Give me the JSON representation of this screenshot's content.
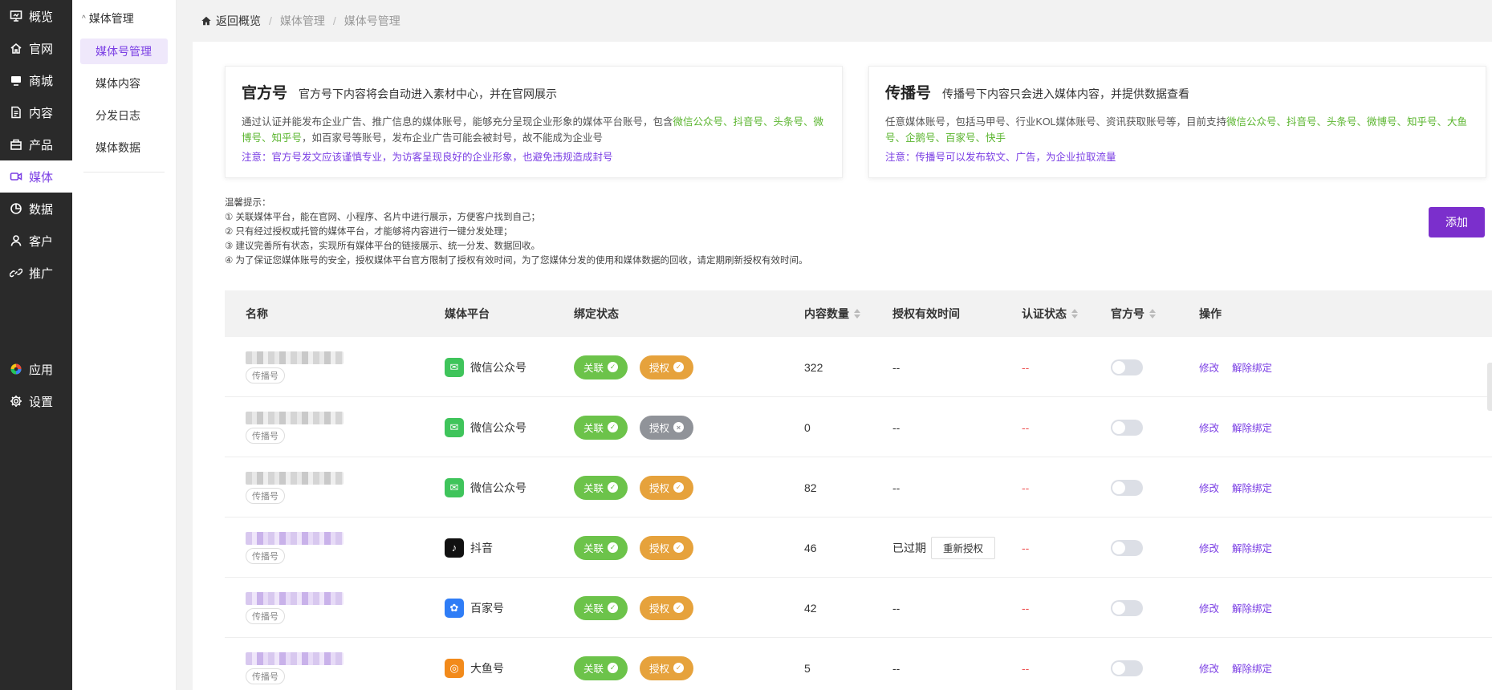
{
  "sidebar": {
    "items": [
      {
        "label": "概览",
        "icon": "dashboard-icon"
      },
      {
        "label": "官网",
        "icon": "home-icon"
      },
      {
        "label": "商城",
        "icon": "shop-icon"
      },
      {
        "label": "内容",
        "icon": "document-icon"
      },
      {
        "label": "产品",
        "icon": "product-icon"
      },
      {
        "label": "媒体",
        "icon": "media-icon",
        "active": true
      },
      {
        "label": "数据",
        "icon": "chart-icon"
      },
      {
        "label": "客户",
        "icon": "user-icon"
      },
      {
        "label": "推广",
        "icon": "link-icon"
      }
    ],
    "bottom": [
      {
        "label": "应用",
        "icon": "apps-icon"
      },
      {
        "label": "设置",
        "icon": "gear-icon"
      }
    ]
  },
  "submenu": {
    "title": "媒体管理",
    "items": [
      "媒体号管理",
      "媒体内容",
      "分发日志",
      "媒体数据"
    ]
  },
  "breadcrumb": {
    "home": "返回概览",
    "crumbs": [
      "媒体管理",
      "媒体号管理"
    ]
  },
  "cards": {
    "official": {
      "title": "官方号",
      "subtitle": "官方号下内容将会自动进入素材中心，并在官网展示",
      "desc_prefix": "通过认证并能发布企业广告、推广信息的媒体账号，能够充分呈现企业形象的媒体平台账号，包含",
      "desc_platforms": "微信公众号、抖音号、头条号、微博号、知乎号",
      "desc_suffix": "，如百家号等账号，发布企业广告可能会被封号，故不能成为企业号",
      "note": "注意：官方号发文应该谨慎专业，为访客呈现良好的企业形象，也避免违规造成封号"
    },
    "spread": {
      "title": "传播号",
      "subtitle": "传播号下内容只会进入媒体内容，并提供数据查看",
      "desc_prefix": "任意媒体账号，包括马甲号、行业KOL媒体账号、资讯获取账号等，目前支持",
      "desc_platforms": "微信公众号、抖音号、头条号、微博号、知乎号、大鱼号、企鹅号、百家号、快手",
      "note": "注意：传播号可以发布软文、广告，为企业拉取流量"
    }
  },
  "tips": [
    "温馨提示：",
    "① 关联媒体平台，能在官网、小程序、名片中进行展示，方便客户找到自己；",
    "② 只有经过授权或托管的媒体平台，才能够将内容进行一键分发处理；",
    "③ 建议完善所有状态，实现所有媒体平台的链接展示、统一分发、数据回收。",
    "④ 为了保证您媒体账号的安全，授权媒体平台官方限制了授权有效时间，为了您媒体分发的使用和媒体数据的回收，请定期刷新授权有效时间。"
  ],
  "add_label": "添加",
  "table": {
    "headers": {
      "name": "名称",
      "platform": "媒体平台",
      "bind": "绑定状态",
      "count": "内容数量",
      "auth_time": "授权有效时间",
      "verify": "认证状态",
      "official": "官方号",
      "ops": "操作"
    },
    "rows": [
      {
        "tag": "传播号",
        "blur": "gray",
        "platform": "微信公众号",
        "platform_icon": "wechat-icon",
        "platform_color": "#3fc45b",
        "link": "关联",
        "auth": "授权",
        "auth_ok": true,
        "count": "322",
        "auth_time": "--",
        "verify": "--",
        "official_on": false
      },
      {
        "tag": "传播号",
        "blur": "gray",
        "platform": "微信公众号",
        "platform_icon": "wechat-icon",
        "platform_color": "#3fc45b",
        "link": "关联",
        "auth": "授权",
        "auth_ok": false,
        "count": "0",
        "auth_time": "--",
        "verify": "--",
        "official_on": false
      },
      {
        "tag": "传播号",
        "blur": "gray",
        "platform": "微信公众号",
        "platform_icon": "wechat-icon",
        "platform_color": "#3fc45b",
        "link": "关联",
        "auth": "授权",
        "auth_ok": true,
        "count": "82",
        "auth_time": "--",
        "verify": "--",
        "official_on": false
      },
      {
        "tag": "传播号",
        "blur": "purple",
        "platform": "抖音",
        "platform_icon": "douyin-icon",
        "platform_color": "#111111",
        "link": "关联",
        "auth": "授权",
        "auth_ok": true,
        "count": "46",
        "auth_time": "已过期",
        "reauth": "重新授权",
        "verify": "--",
        "official_on": false
      },
      {
        "tag": "传播号",
        "blur": "purple",
        "platform": "百家号",
        "platform_icon": "baijiahao-icon",
        "platform_color": "#2f7df6",
        "link": "关联",
        "auth": "授权",
        "auth_ok": true,
        "count": "42",
        "auth_time": "--",
        "verify": "--",
        "official_on": false
      },
      {
        "tag": "传播号",
        "blur": "purple",
        "platform": "大鱼号",
        "platform_icon": "dayu-icon",
        "platform_color": "#f28a1b",
        "link": "关联",
        "auth": "授权",
        "auth_ok": true,
        "count": "5",
        "auth_time": "--",
        "verify": "--",
        "official_on": false
      }
    ],
    "op_edit": "修改",
    "op_unbind": "解除绑定"
  },
  "colors": {
    "accent": "#7b3fe4",
    "button": "#7b2fcc",
    "green": "#6cc34a",
    "orange": "#e6a23c",
    "gray": "#909399"
  }
}
